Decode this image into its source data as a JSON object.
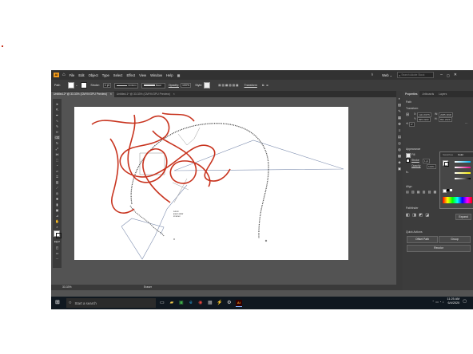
{
  "menu": {
    "items": [
      "File",
      "Edit",
      "Object",
      "Type",
      "Select",
      "Effect",
      "View",
      "Window",
      "Help"
    ],
    "workspace": "Web",
    "search_placeholder": "Search Adobe Stock"
  },
  "control_bar": {
    "selection": "Path",
    "stroke_label": "Stroke:",
    "stroke_value": "1 pt",
    "uniform": "Uniform",
    "brush": "Basic",
    "opacity_label": "Opacity:",
    "opacity_value": "100%",
    "style_label": "Style:",
    "transform": "Transform"
  },
  "doc_tabs": [
    {
      "label": "Untitled-2* @ 33.33% (CMYK/GPU Preview)",
      "active": true
    },
    {
      "label": "Untitled-1* @ 33.33% (CMYK/GPU Preview)",
      "active": false
    }
  ],
  "status_bar": {
    "zoom": "33.33%",
    "tool": "Eraser"
  },
  "canvas": {
    "note_lines": [
      "Lorem",
      "ipsum dolor",
      "sit amet"
    ]
  },
  "properties": {
    "tabs": [
      "Properties",
      "Artboards",
      "Layers"
    ],
    "section_path": "Path",
    "section_transform": "Transform",
    "x_label": "X:",
    "x_value": "1113.8375",
    "y_label": "Y:",
    "y_value": "895.3193",
    "w_label": "W:",
    "w_value": "2085.3836",
    "h_label": "H:",
    "h_value": "891.2329",
    "angle_value": "0°",
    "section_appearance": "Appearance",
    "fill_label": "Fill",
    "stroke_label": "Stroke",
    "stroke_value": "1 pt",
    "opacity_label": "Opacity",
    "opacity_value": "100%",
    "fx_label": "fx.",
    "section_align": "Align",
    "section_pathfinder": "Pathfinder",
    "expand": "Expand",
    "section_quick_actions": "Quick Actions",
    "offset_path": "Offset Path",
    "group": "Group",
    "recolor": "Recolor",
    "popup_tabs": [
      "Swatches",
      "Color"
    ]
  },
  "taskbar": {
    "search_text": "Start a search",
    "time": "11:25 AM",
    "date": "6/4/2020"
  },
  "colors": {
    "accent_red": "#c8341f",
    "ui_dark": "#323232",
    "ui_panel": "#3c3c3c",
    "workspace": "#535353",
    "taskbar": "#101820"
  }
}
